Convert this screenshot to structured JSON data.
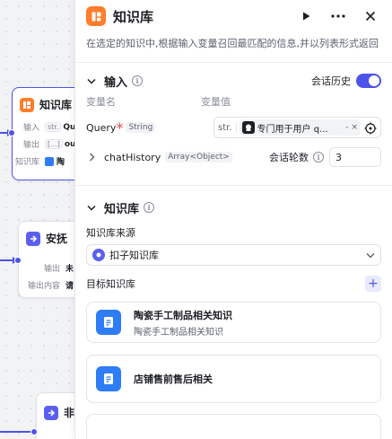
{
  "canvas": {
    "node1": {
      "title": "知识库",
      "rows": [
        {
          "key": "输入",
          "chip": "str.",
          "value": "Qu"
        },
        {
          "key": "输出",
          "chip": "[...]",
          "value": "ou"
        },
        {
          "key": "知识库",
          "chip": "",
          "value": "陶"
        }
      ]
    },
    "node2": {
      "title": "安抚",
      "rows": [
        {
          "key": "输出",
          "value": "未"
        },
        {
          "key": "输出内容",
          "value": "请"
        }
      ]
    },
    "node3": {
      "title": "非",
      "rows": [
        {
          "key": "输出",
          "value": ""
        }
      ]
    }
  },
  "panel": {
    "title": "知识库",
    "description": "在选定的知识中,根据输入变量召回最匹配的信息,并以列表形式返回",
    "input_section": {
      "label": "输入",
      "history_label": "会话历史",
      "history_enabled": true,
      "col_name": "变量名",
      "col_value": "变量值",
      "query": {
        "name": "Query",
        "type": "String",
        "ref_type": "str.",
        "ref_text": "专门用于用户 q...",
        "ref_suffix": "-",
        "remove": "×"
      },
      "chat_history": {
        "name": "chatHistory",
        "type": "Array<Object>",
        "rounds_label": "会话轮数",
        "rounds_value": "3"
      }
    },
    "kb_section": {
      "label": "知识库",
      "source_label": "知识库来源",
      "source_value": "扣子知识库",
      "target_label": "目标知识库",
      "add": "+",
      "cards": [
        {
          "title": "陶瓷手工制品相关知识",
          "subtitle": "陶瓷手工制品相关知识"
        },
        {
          "title": "店铺售前售后相关",
          "subtitle": ""
        }
      ]
    }
  },
  "colors": {
    "accent": "#4d53e8",
    "orange": "#ff7d2b",
    "blue": "#2e7cf6"
  }
}
